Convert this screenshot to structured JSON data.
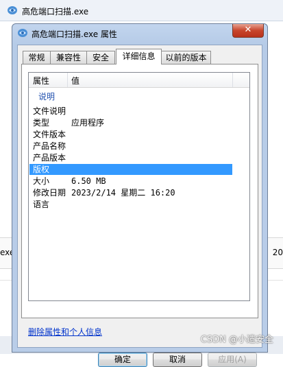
{
  "background_window": {
    "title": "高危端口扫描.exe",
    "left_fragment": "exe",
    "right_fragment": "20"
  },
  "dialog": {
    "title": "高危端口扫描.exe 属性",
    "close_label": "✕",
    "tabs": [
      {
        "label": "常规",
        "active": false
      },
      {
        "label": "兼容性",
        "active": false
      },
      {
        "label": "安全",
        "active": false
      },
      {
        "label": "详细信息",
        "active": true
      },
      {
        "label": "以前的版本",
        "active": false
      }
    ],
    "table": {
      "headers": [
        "属性",
        "值"
      ],
      "group": "说明",
      "rows": [
        {
          "name": "文件说明",
          "value": ""
        },
        {
          "name": "类型",
          "value": "应用程序"
        },
        {
          "name": "文件版本",
          "value": ""
        },
        {
          "name": "产品名称",
          "value": ""
        },
        {
          "name": "产品版本",
          "value": ""
        },
        {
          "name": "版权",
          "value": "",
          "selected": true
        },
        {
          "name": "大小",
          "value": "6.50 MB"
        },
        {
          "name": "修改日期",
          "value": "2023/2/14 星期二 16:20"
        },
        {
          "name": "语言",
          "value": ""
        }
      ]
    },
    "remove_link": "删除属性和个人信息",
    "buttons": {
      "ok": "确定",
      "cancel": "取消",
      "apply": "应用(A)"
    }
  },
  "watermark": "CSDN @小遗安全",
  "colors": {
    "selection": "#3399ff",
    "link": "#0033cc",
    "group_header": "#1f4fae",
    "close_button": "#c8452c"
  }
}
